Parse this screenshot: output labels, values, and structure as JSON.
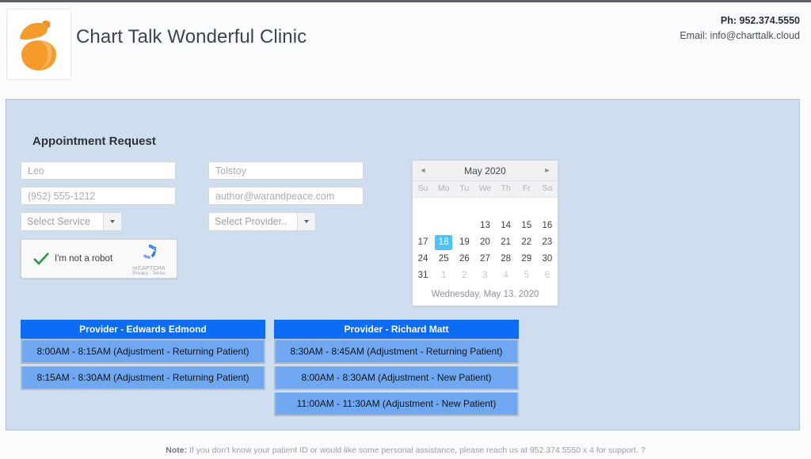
{
  "header": {
    "logo_alt": "acorn-logo",
    "clinic_name": "Chart Talk Wonderful Clinic",
    "phone": "Ph: 952.374.5550",
    "email": "Email: info@charttalk.cloud"
  },
  "panel": {
    "title": "Appointment Request"
  },
  "form": {
    "first_name": {
      "value": "",
      "placeholder": "Leo"
    },
    "last_name": {
      "value": "",
      "placeholder": "Tolstoy"
    },
    "phone": {
      "value": "",
      "placeholder": "(952) 555-1212"
    },
    "email": {
      "value": "",
      "placeholder": "author@warandpeace.com"
    },
    "service_select": "Select Service",
    "provider_select": "Select Provider.."
  },
  "recaptcha": {
    "label": "I'm not a robot",
    "brand": "reCAPTCHA",
    "legal": "Privacy - Terms"
  },
  "calendar": {
    "prev_label": "◄",
    "next_label": "►",
    "month": "May 2020",
    "dow": [
      "Su",
      "Mo",
      "Tu",
      "We",
      "Th",
      "Fr",
      "Sa"
    ],
    "weeks": [
      [
        {
          "label": "",
          "state": "blank"
        },
        {
          "label": "",
          "state": "blank"
        },
        {
          "label": "",
          "state": "blank"
        },
        {
          "label": "",
          "state": "blank"
        },
        {
          "label": "",
          "state": "blank"
        },
        {
          "label": "",
          "state": "blank"
        },
        {
          "label": "",
          "state": "blank"
        }
      ],
      [
        {
          "label": "",
          "state": "blank"
        },
        {
          "label": "",
          "state": "blank"
        },
        {
          "label": "",
          "state": "blank"
        },
        {
          "label": "13",
          "state": "normal"
        },
        {
          "label": "14",
          "state": "normal"
        },
        {
          "label": "15",
          "state": "normal"
        },
        {
          "label": "16",
          "state": "normal"
        }
      ],
      [
        {
          "label": "17",
          "state": "normal"
        },
        {
          "label": "18",
          "state": "selected"
        },
        {
          "label": "19",
          "state": "normal"
        },
        {
          "label": "20",
          "state": "normal"
        },
        {
          "label": "21",
          "state": "normal"
        },
        {
          "label": "22",
          "state": "normal"
        },
        {
          "label": "23",
          "state": "normal"
        }
      ],
      [
        {
          "label": "24",
          "state": "normal"
        },
        {
          "label": "25",
          "state": "normal"
        },
        {
          "label": "26",
          "state": "normal"
        },
        {
          "label": "27",
          "state": "normal"
        },
        {
          "label": "28",
          "state": "normal"
        },
        {
          "label": "29",
          "state": "normal"
        },
        {
          "label": "30",
          "state": "normal"
        }
      ],
      [
        {
          "label": "31",
          "state": "normal"
        },
        {
          "label": "1",
          "state": "muted"
        },
        {
          "label": "2",
          "state": "muted"
        },
        {
          "label": "3",
          "state": "muted"
        },
        {
          "label": "4",
          "state": "muted"
        },
        {
          "label": "5",
          "state": "muted"
        },
        {
          "label": "6",
          "state": "muted"
        }
      ]
    ],
    "footer_date": "Wednesday, May 13, 2020",
    "selected_day": "18",
    "highlight_color": "#4dc3f7"
  },
  "providers": [
    {
      "header": "Provider - Edwards Edmond",
      "slots": [
        "8:00AM - 8:15AM (Adjustment - Returning Patient)",
        "8:15AM - 8:30AM (Adjustment - Returning Patient)"
      ]
    },
    {
      "header": "Provider - Richard Matt",
      "slots": [
        "8:30AM - 8:45AM (Adjustment - Returning Patient)",
        "8:00AM - 8:30AM (Adjustment - New Patient)",
        "11:00AM - 11:30AM (Adjustment - New Patient)"
      ]
    }
  ],
  "footer": {
    "note_label": "Note:",
    "note_text": " If you don't know your patient ID or would like some personal assistance, please reach us at 952.374.5550 x 4 for support. ?"
  },
  "colors": {
    "panel_bg": "#cfdeef",
    "provider_header": "#0b6cf5",
    "slot_bg": "#6fa8f0",
    "logo_orange": "#f59b2a"
  }
}
